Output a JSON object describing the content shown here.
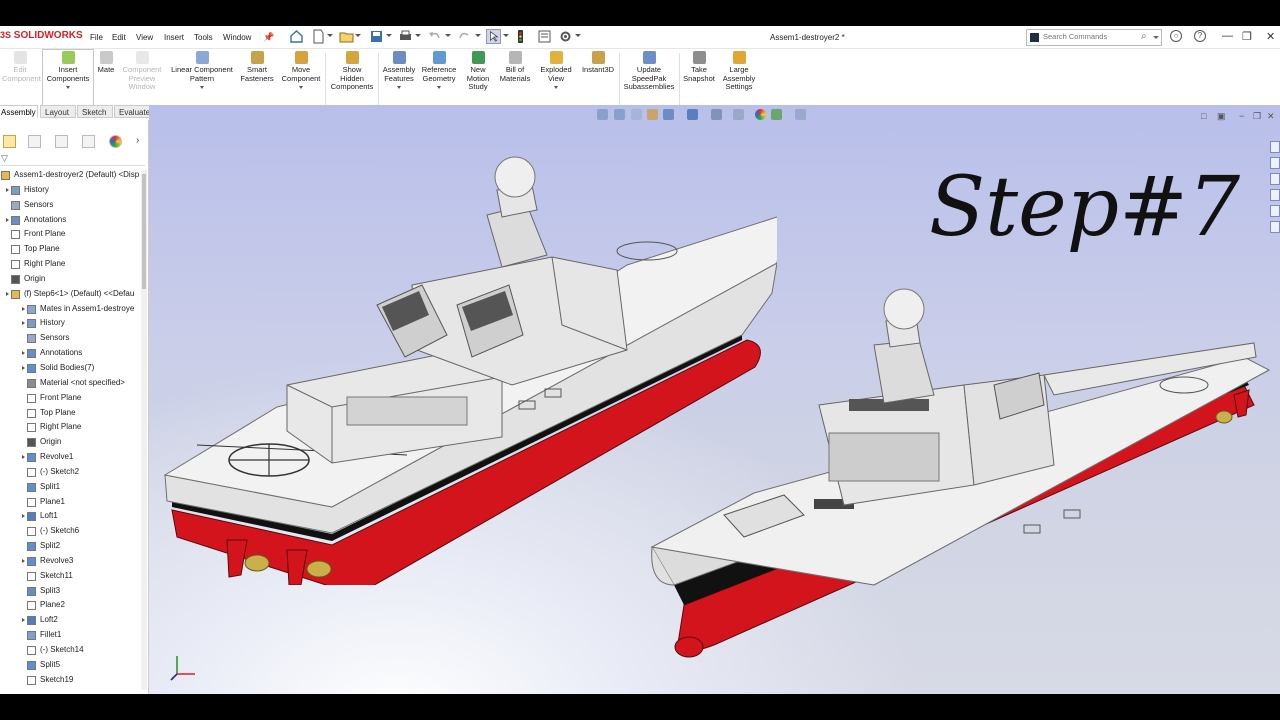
{
  "app": {
    "logo_prefix": "3S",
    "logo_name": "SOLIDWORKS",
    "menu": [
      "File",
      "Edit",
      "View",
      "Insert",
      "Tools",
      "Window"
    ],
    "document_title": "Assem1-destroyer2 *",
    "search_placeholder": "Search Commands"
  },
  "command_manager": [
    {
      "label": "Edit\nComponent",
      "disabled": true
    },
    {
      "label": "Insert\nComponents",
      "disabled": false
    },
    {
      "label": "Mate",
      "disabled": false
    },
    {
      "label": "Component\nPreview\nWindow",
      "disabled": true
    },
    {
      "label": "Linear Component\nPattern",
      "disabled": false
    },
    {
      "label": "Smart\nFasteners",
      "disabled": false
    },
    {
      "label": "Move\nComponent",
      "disabled": false
    },
    {
      "label": "Show\nHidden\nComponents",
      "disabled": false
    },
    {
      "label": "Assembly\nFeatures",
      "disabled": false
    },
    {
      "label": "Reference\nGeometry",
      "disabled": false
    },
    {
      "label": "New\nMotion\nStudy",
      "disabled": false
    },
    {
      "label": "Bill of\nMaterials",
      "disabled": false
    },
    {
      "label": "Exploded\nView",
      "disabled": false
    },
    {
      "label": "Instant3D",
      "disabled": false
    },
    {
      "label": "Update\nSpeedPak\nSubassemblies",
      "disabled": false
    },
    {
      "label": "Take\nSnapshot",
      "disabled": false
    },
    {
      "label": "Large\nAssembly\nSettings",
      "disabled": false
    }
  ],
  "tabs": [
    {
      "label": "Assembly",
      "active": true
    },
    {
      "label": "Layout",
      "active": false
    },
    {
      "label": "Sketch",
      "active": false
    },
    {
      "label": "Evaluate",
      "active": false
    }
  ],
  "feature_tree": [
    {
      "label": "Assem1-destroyer2 (Default) <Disp",
      "icon": "assembly-icon",
      "level": 0,
      "expand": false
    },
    {
      "label": "History",
      "icon": "history-icon",
      "level": 1,
      "expand": true
    },
    {
      "label": "Sensors",
      "icon": "sensors-icon",
      "level": 1,
      "expand": false
    },
    {
      "label": "Annotations",
      "icon": "annotations-icon",
      "level": 1,
      "expand": true
    },
    {
      "label": "Front Plane",
      "icon": "plane-icon",
      "level": 1,
      "expand": false
    },
    {
      "label": "Top Plane",
      "icon": "plane-icon",
      "level": 1,
      "expand": false
    },
    {
      "label": "Right Plane",
      "icon": "plane-icon",
      "level": 1,
      "expand": false
    },
    {
      "label": "Origin",
      "icon": "origin-icon",
      "level": 1,
      "expand": false
    },
    {
      "label": "(f) Step6<1> (Default) <<Defau",
      "icon": "part-icon",
      "level": 1,
      "expand": true
    },
    {
      "label": "Mates in Assem1-destroye",
      "icon": "mates-icon",
      "level": 2,
      "expand": true
    },
    {
      "label": "History",
      "icon": "history-icon",
      "level": 2,
      "expand": true
    },
    {
      "label": "Sensors",
      "icon": "sensors-icon",
      "level": 2,
      "expand": false
    },
    {
      "label": "Annotations",
      "icon": "annotations-icon",
      "level": 2,
      "expand": true
    },
    {
      "label": "Solid Bodies(7)",
      "icon": "solid-bodies-icon",
      "level": 2,
      "expand": true
    },
    {
      "label": "Material <not specified>",
      "icon": "material-icon",
      "level": 2,
      "expand": false
    },
    {
      "label": "Front Plane",
      "icon": "plane-icon",
      "level": 2,
      "expand": false
    },
    {
      "label": "Top Plane",
      "icon": "plane-icon",
      "level": 2,
      "expand": false
    },
    {
      "label": "Right Plane",
      "icon": "plane-icon",
      "level": 2,
      "expand": false
    },
    {
      "label": "Origin",
      "icon": "origin-icon",
      "level": 2,
      "expand": false
    },
    {
      "label": "Revolve1",
      "icon": "revolve-icon",
      "level": 2,
      "expand": true
    },
    {
      "label": "(-) Sketch2",
      "icon": "sketch-icon",
      "level": 2,
      "expand": false
    },
    {
      "label": "Split1",
      "icon": "split-icon",
      "level": 2,
      "expand": false
    },
    {
      "label": "Plane1",
      "icon": "plane-icon",
      "level": 2,
      "expand": false
    },
    {
      "label": "Loft1",
      "icon": "loft-icon",
      "level": 2,
      "expand": true
    },
    {
      "label": "(-) Sketch6",
      "icon": "sketch-icon",
      "level": 2,
      "expand": false
    },
    {
      "label": "Split2",
      "icon": "split-icon",
      "level": 2,
      "expand": false
    },
    {
      "label": "Revolve3",
      "icon": "revolve-icon",
      "level": 2,
      "expand": true
    },
    {
      "label": "Sketch11",
      "icon": "sketch-icon",
      "level": 2,
      "expand": false
    },
    {
      "label": "Split3",
      "icon": "split-icon",
      "level": 2,
      "expand": false
    },
    {
      "label": "Plane2",
      "icon": "plane-icon",
      "level": 2,
      "expand": false
    },
    {
      "label": "Loft2",
      "icon": "loft-icon",
      "level": 2,
      "expand": true
    },
    {
      "label": "Fillet1",
      "icon": "fillet-icon",
      "level": 2,
      "expand": false
    },
    {
      "label": "(-) Sketch14",
      "icon": "sketch-icon",
      "level": 2,
      "expand": false
    },
    {
      "label": "Split5",
      "icon": "split-icon",
      "level": 2,
      "expand": false
    },
    {
      "label": "Sketch19",
      "icon": "sketch-icon",
      "level": 2,
      "expand": false
    }
  ],
  "viewport": {
    "overlay_text": "Step#7"
  },
  "colors": {
    "hull_red": "#d4141c",
    "hull_white": "#e6e6e6",
    "logo_red": "#d32027"
  }
}
